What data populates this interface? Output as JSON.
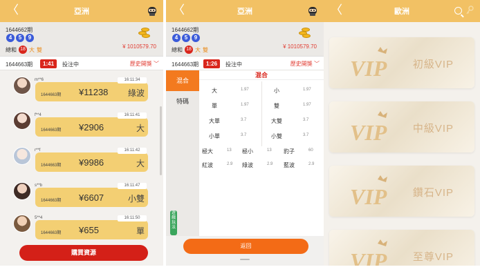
{
  "screen1": {
    "title": "亞洲",
    "back_glyph": "〈",
    "draw": {
      "issue": "1644662期",
      "balls": [
        "4",
        "5",
        "9"
      ],
      "sum_prefix": "總和",
      "sum": "18",
      "size": "大",
      "parity": "雙",
      "balance": "¥ 1010579.70"
    },
    "current": {
      "issue": "1644663期",
      "timer": "1:41",
      "state": "投注中",
      "history": "歷史開獎"
    },
    "messages": [
      {
        "user": "m**6",
        "time": "16:11:34",
        "issue": "1644663期",
        "amount": "¥11238",
        "pick": "綠波"
      },
      {
        "user": "f**4",
        "time": "16:11:41",
        "issue": "1644663期",
        "amount": "¥2906",
        "pick": "大"
      },
      {
        "user": "r**f",
        "time": "16:11:42",
        "issue": "1644663期",
        "amount": "¥9986",
        "pick": "大"
      },
      {
        "user": "s**b",
        "time": "16:11:47",
        "issue": "1644663期",
        "amount": "¥6607",
        "pick": "小雙"
      },
      {
        "user": "5**4",
        "time": "16:11:50",
        "issue": "1644663期",
        "amount": "¥655",
        "pick": "單"
      }
    ],
    "buy_button": "購買資源"
  },
  "screen2": {
    "title": "亞洲",
    "back_glyph": "〈",
    "draw": {
      "issue": "1644662期",
      "balls": [
        "4",
        "5",
        "9"
      ],
      "sum_prefix": "總和",
      "sum": "18",
      "size": "大",
      "parity": "雙",
      "balance": "¥ 1010579.70"
    },
    "current": {
      "issue": "1644663期",
      "timer": "1:26",
      "state": "投注中",
      "history": "歷史開獎"
    },
    "side_tabs": [
      "混合",
      "特碼"
    ],
    "float_tab": "遊戲玩法",
    "grid_title": "混合",
    "bets": [
      {
        "name": "大",
        "odds": "1.97"
      },
      {
        "name": "小",
        "odds": "1.97"
      },
      {
        "name": "單",
        "odds": "1.97"
      },
      {
        "name": "雙",
        "odds": "1.97"
      },
      {
        "name": "大單",
        "odds": "3.7"
      },
      {
        "name": "大雙",
        "odds": "3.7"
      },
      {
        "name": "小單",
        "odds": "3.7"
      },
      {
        "name": "小雙",
        "odds": "3.7"
      },
      {
        "name": "極大",
        "odds": "13"
      },
      {
        "name": "極小",
        "odds": "13"
      },
      {
        "name": "豹子",
        "odds": "60"
      },
      {
        "name": "紅波",
        "odds": "2.9"
      },
      {
        "name": "綠波",
        "odds": "2.9"
      },
      {
        "name": "藍波",
        "odds": "2.9"
      }
    ],
    "back_button": "返回"
  },
  "screen3": {
    "title": "歐洲",
    "back_glyph": "〈",
    "vip_logo_text": "VIP",
    "tiers": [
      "初級VIP",
      "中級VIP",
      "鑽石VIP",
      "至尊VIP"
    ]
  },
  "colors": {
    "header": "#f2c164",
    "accent_red": "#d9261c",
    "orange": "#f36b16",
    "bubble": "#f3cf73",
    "ball_blue": "#3b5bd9"
  },
  "icons": [
    "back-arrow-icon",
    "robot-icon",
    "gold-coins-icon",
    "chevron-down-icon",
    "search-icon",
    "key-icon",
    "vip-crown-icon"
  ]
}
